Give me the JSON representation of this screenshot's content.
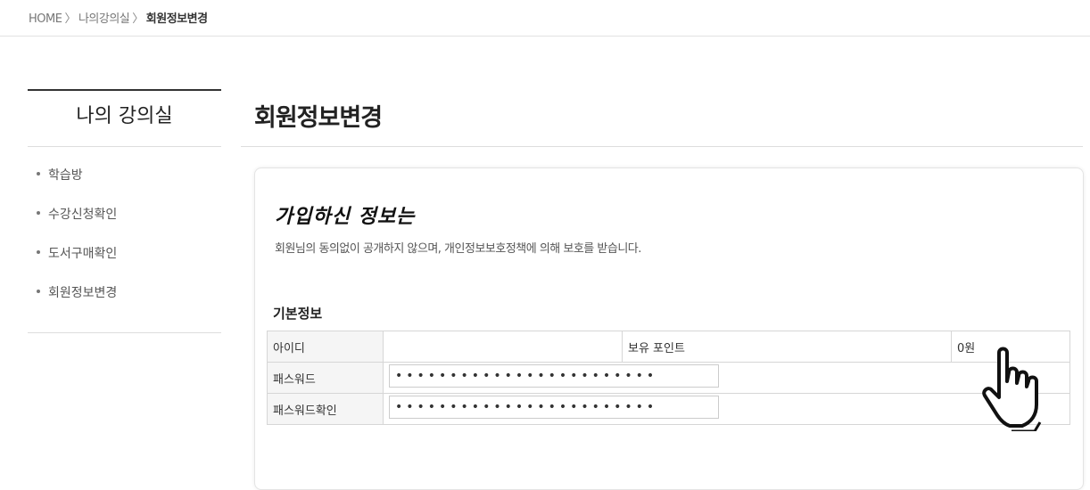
{
  "breadcrumb": {
    "home": "HOME",
    "separator": "〉",
    "level1": "나의강의실",
    "current": "회원정보변경"
  },
  "sidebar": {
    "title": "나의 강의실",
    "items": [
      {
        "label": "학습방"
      },
      {
        "label": "수강신청확인"
      },
      {
        "label": "도서구매확인"
      },
      {
        "label": "회원정보변경"
      }
    ]
  },
  "main": {
    "title": "회원정보변경",
    "panel": {
      "heading": "가입하신 정보는",
      "notice": "회원님의 동의없이 공개하지 않으며, 개인정보보호정책에 의해 보호를 받습니다.",
      "section_title": "기본정보",
      "fields": {
        "id_label": "아이디",
        "id_value": "",
        "points_label": "보유 포인트",
        "points_value": "0원",
        "password_label": "패스워드",
        "password_value": "••••••••••••••••••••••••",
        "password_confirm_label": "패스워드확인",
        "password_confirm_value": "••••••••••••••••••••••••"
      }
    }
  },
  "icons": {
    "cursor": "hand-pointer-icon"
  }
}
